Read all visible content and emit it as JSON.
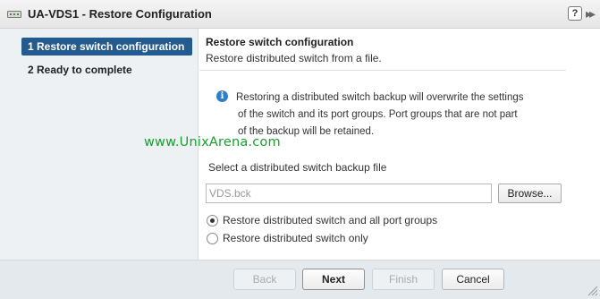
{
  "window": {
    "title": "UA-VDS1 - Restore Configuration",
    "help_label": "?",
    "expand_label": "▸▸"
  },
  "sidebar": {
    "steps": [
      {
        "label": "1  Restore switch configuration",
        "active": true
      },
      {
        "label": "2  Ready to complete",
        "active": false
      }
    ]
  },
  "main": {
    "heading": "Restore switch configuration",
    "subheading": "Restore distributed switch from a file.",
    "info_icon": "i",
    "info_lines": [
      "Restoring a distributed switch backup will overwrite the settings",
      "of the switch and its port groups. Port groups that are not  part",
      "of the backup will be retained."
    ],
    "watermark": "www.UnixArena.com",
    "file_label": "Select a distributed switch backup file",
    "file_value": "VDS.bck",
    "browse_label": "Browse...",
    "radio_options": [
      {
        "label": "Restore distributed switch and all port groups",
        "checked": true
      },
      {
        "label": "Restore distributed switch only",
        "checked": false
      }
    ]
  },
  "footer": {
    "back_label": "Back",
    "next_label": "Next",
    "finish_label": "Finish",
    "cancel_label": "Cancel"
  },
  "colors": {
    "active_step_bg": "#245b8f",
    "sidebar_bg": "#edf1f4",
    "footer_bg": "#e4e9ed",
    "info_icon": "#2e7fc7",
    "watermark": "#16a02e"
  }
}
